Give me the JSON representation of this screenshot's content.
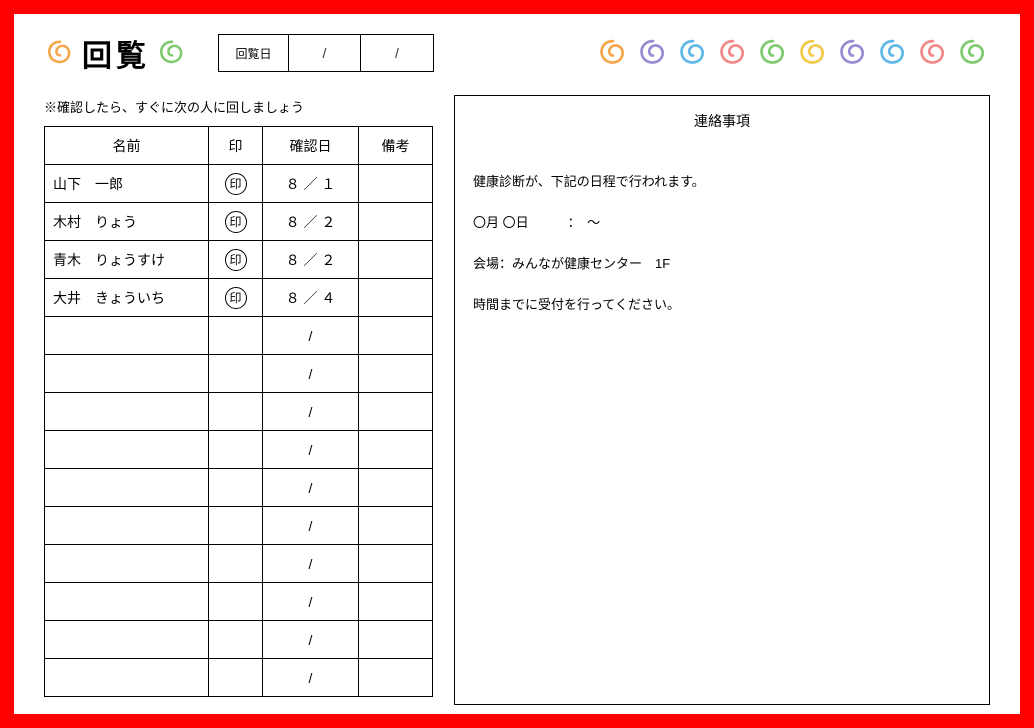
{
  "title": "回覧",
  "date_label": "回覧日",
  "date_cells": [
    "/",
    "/"
  ],
  "note": "※確認したら、すぐに次の人に回しましょう",
  "headers": {
    "name": "名前",
    "seal": "印",
    "date": "確認日",
    "remark": "備考"
  },
  "seal_char": "印",
  "rows": [
    {
      "name": "山下　一郎",
      "sealed": true,
      "date": "８ ／ １",
      "remark": ""
    },
    {
      "name": "木村　りょう",
      "sealed": true,
      "date": "８ ／ ２",
      "remark": ""
    },
    {
      "name": "青木　りょうすけ",
      "sealed": true,
      "date": "８ ／ ２",
      "remark": ""
    },
    {
      "name": "大井　きょういち",
      "sealed": true,
      "date": "８ ／ ４",
      "remark": ""
    },
    {
      "name": "",
      "sealed": false,
      "date": "/",
      "remark": ""
    },
    {
      "name": "",
      "sealed": false,
      "date": "/",
      "remark": ""
    },
    {
      "name": "",
      "sealed": false,
      "date": "/",
      "remark": ""
    },
    {
      "name": "",
      "sealed": false,
      "date": "/",
      "remark": ""
    },
    {
      "name": "",
      "sealed": false,
      "date": "/",
      "remark": ""
    },
    {
      "name": "",
      "sealed": false,
      "date": "/",
      "remark": ""
    },
    {
      "name": "",
      "sealed": false,
      "date": "/",
      "remark": ""
    },
    {
      "name": "",
      "sealed": false,
      "date": "/",
      "remark": ""
    },
    {
      "name": "",
      "sealed": false,
      "date": "/",
      "remark": ""
    },
    {
      "name": "",
      "sealed": false,
      "date": "/",
      "remark": ""
    }
  ],
  "notice": {
    "heading": "連絡事項",
    "lines": [
      "健康診断が、下記の日程で行われます。",
      "〇月 〇日　　　：　～",
      "会場：みんなが健康センター　1F",
      "時間までに受付を行ってください。"
    ]
  },
  "spiral_colors": {
    "title_left": "#f4a64a",
    "title_right": "#7fc96f",
    "row": [
      "#f4a64a",
      "#9a8bd4",
      "#5fb8e8",
      "#f08a8a",
      "#7fc96f",
      "#f2c94c",
      "#9a8bd4",
      "#5fb8e8",
      "#f08a8a",
      "#7fc96f"
    ]
  }
}
